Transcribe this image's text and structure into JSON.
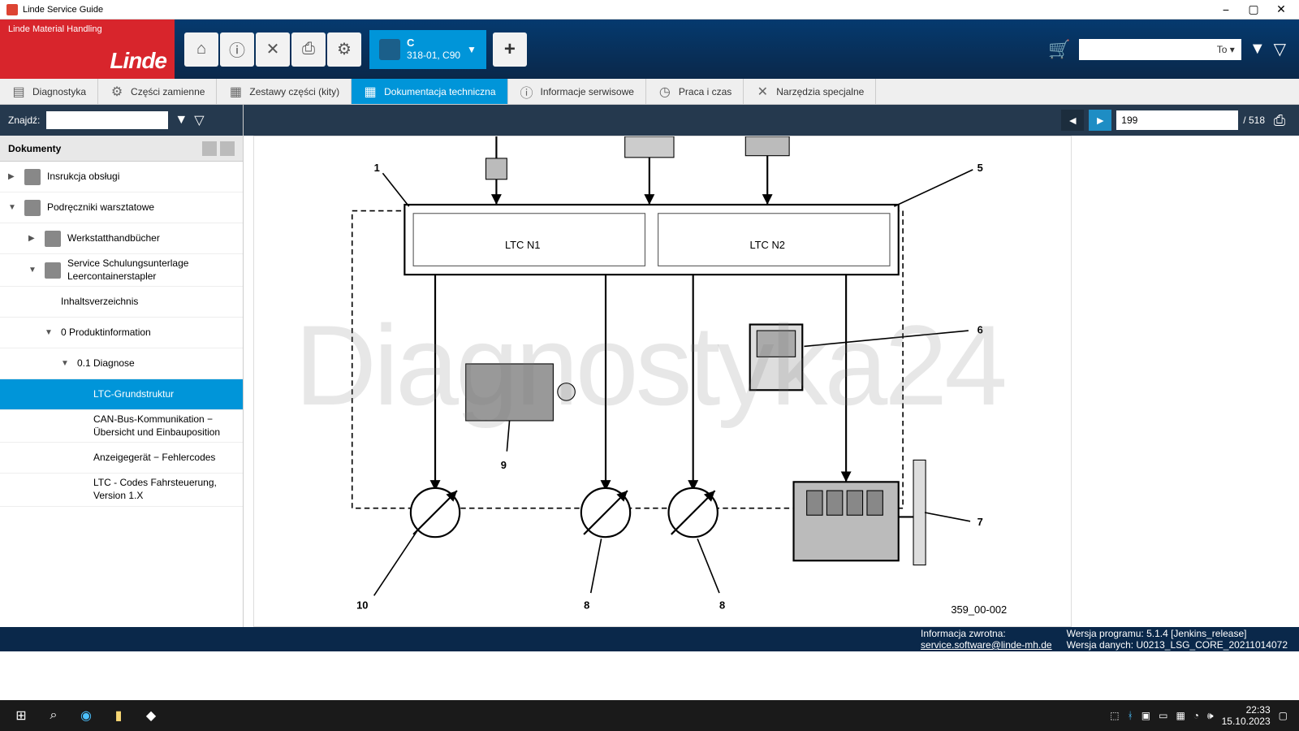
{
  "title": "Linde Service Guide",
  "logo": {
    "small": "Linde Material Handling",
    "big": "Linde"
  },
  "vehicle": {
    "model": "C",
    "sub": "318-01, C90"
  },
  "tosel": "To ▾",
  "tabs": [
    "Diagnostyka",
    "Części zamienne",
    "Zestawy części (kity)",
    "Dokumentacja techniczna",
    "Informacje serwisowe",
    "Praca i czas",
    "Narzędzia specjalne"
  ],
  "active_tab": 3,
  "find_label": "Znajdź:",
  "dok_header": "Dokumenty",
  "tree": [
    {
      "lvl": 0,
      "arr": "▶",
      "ico": true,
      "lbl": "Insrukcja obsługi"
    },
    {
      "lvl": 0,
      "arr": "▼",
      "ico": true,
      "lbl": "Podręczniki warsztatowe"
    },
    {
      "lvl": 1,
      "arr": "▶",
      "ico": true,
      "lbl": "Werkstatthandbücher"
    },
    {
      "lvl": 1,
      "arr": "▼",
      "ico": true,
      "lbl": "Service Schulungsunterlage Leercontainerstapler"
    },
    {
      "lvl": 2,
      "arr": "",
      "ico": false,
      "lbl": "Inhaltsverzeichnis"
    },
    {
      "lvl": 2,
      "arr": "▼",
      "ico": false,
      "lbl": "0 Produktinformation"
    },
    {
      "lvl": 3,
      "arr": "▼",
      "ico": false,
      "lbl": "0.1 Diagnose"
    },
    {
      "lvl": 4,
      "arr": "",
      "ico": false,
      "lbl": "LTC-Grundstruktur",
      "sel": true
    },
    {
      "lvl": 4,
      "arr": "",
      "ico": false,
      "lbl": "CAN-Bus-Kommunikation − Übersicht und Einbauposition"
    },
    {
      "lvl": 4,
      "arr": "",
      "ico": false,
      "lbl": "Anzeigegerät − Fehlercodes"
    },
    {
      "lvl": 4,
      "arr": "",
      "ico": false,
      "lbl": "LTC - Codes Fahrsteuerung, Version 1.X"
    }
  ],
  "page": {
    "cur": "199",
    "total": "518"
  },
  "diagram_parts": {
    "n1": "LTC N1",
    "n2": "LTC N2",
    "num": "359_00-002"
  },
  "watermark": "Diagnostyka24",
  "footer": {
    "fb": "Informacja zwrotna:",
    "email": "service.software@linde-mh.de",
    "v1": "Wersja programu: 5.1.4 [Jenkins_release]",
    "v2": "Wersja danych: U0213_LSG_CORE_20211014072"
  },
  "clock": {
    "t": "22:33",
    "d": "15.10.2023"
  }
}
